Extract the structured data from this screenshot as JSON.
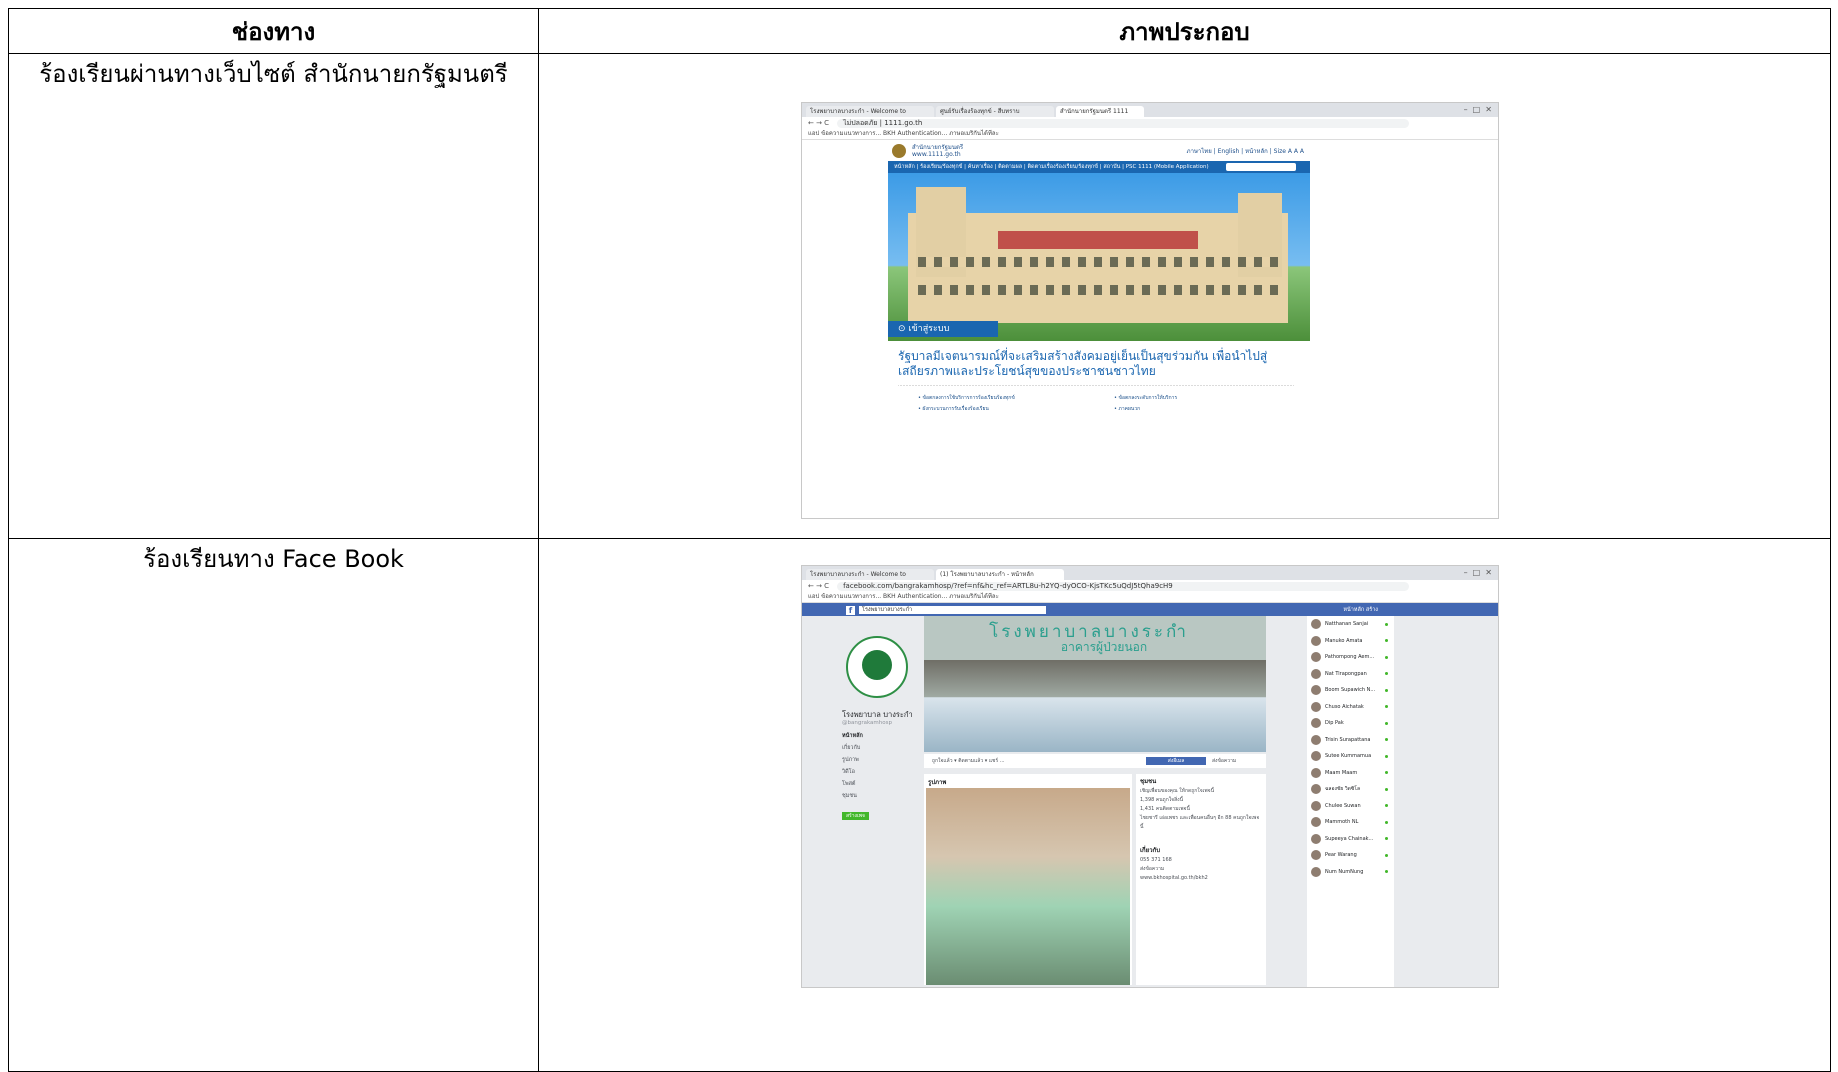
{
  "table": {
    "header_channel": "ช่องทาง",
    "header_image": "ภาพประกอบ",
    "rows": [
      {
        "channel": "ร้องเรียนผ่านทางเว็บไซต์ สำนักนายกรัฐมนตรี"
      },
      {
        "channel": "ร้องเรียนทาง Face Book"
      }
    ]
  },
  "screenshot1": {
    "tabs": [
      "โรงพยาบาลบางระกำ - Welcome to",
      "ศูนย์รับเรื่องร้องทุกข์ - สืบทราบ",
      "สำนักนายกรัฐมนตรี 1111"
    ],
    "url": "ไม่ปลอดภัย | 1111.go.th",
    "bookmarks": "แอป  ข้อความแนวทางการ...  BKH Authentication...  ภาษอเมริกันได้ทีละ",
    "site_name": "สำนักนายกรัฐมนตรี",
    "site_url": "www.1111.go.th",
    "site_links": "ภาษาไทย | English | หน้าหลัก | Size A A A",
    "nav": "หน้าหลัก | ร้องเรียน/ร้องทุกข์ | ค้นหาเรื่อง | ติดตามผล | ติดตามเรื่องร้องเรียน/ร้องทุกข์ | สถาบัน | PSC 1111 (Mobile Application)",
    "login": "เข้าสู่ระบบ",
    "headline": "รัฐบาลมีเจตนารมณ์ที่จะเสริมสร้างสังคมอยู่เย็นเป็นสุขร่วมกัน เพื่อนำไปสู่เสถียรภาพและประโยชน์สุขของประชาชนชาวไทย",
    "bullets": [
      "ข้อตกลงการใช้บริการการร้องเรียนร้องทุกข์",
      "ข้อตกลงระดับการให้บริการ",
      "ผังกระบวนการรับเรื่องร้องเรียน",
      "ภาคผนวก"
    ]
  },
  "screenshot2": {
    "tabs": [
      "โรงพยาบาลบางระกำ - Welcome to",
      "(1) โรงพยาบาลบางระกำ - หน้าหลัก"
    ],
    "url": "facebook.com/bangrakamhosp/?ref=nf&hc_ref=ARTL8u-h2YQ-dyOCO-KjsTKc5uQdJ5tQha9cH9",
    "bookmarks": "แอป  ข้อความแนวทางการ...  BKH Authentication...  ภาษอเมริกันได้ทีละ",
    "search": "โรงพยาบาลบางระกำ",
    "topright": "หน้าหลัก  สร้าง",
    "page_name": "โรงพยาบาล บางระกำ",
    "handle": "@bangrakamhosp",
    "menu": [
      "หน้าหลัก",
      "เกี่ยวกับ",
      "รูปภาพ",
      "วิดีโอ",
      "โพสต์",
      "ชุมชน"
    ],
    "create": "สร้างเพจ",
    "cover_title": "โรงพยาบาลบางระกำ",
    "cover_sub": "อาคารผู้ป่วยนอก",
    "actions": "ถูกใจแล้ว ▾   ติดตามแล้ว ▾   แชร์   ...",
    "send": "ส่งอีเมล",
    "message": "ส่งข้อความ",
    "photos": "รูปภาพ",
    "community": "ชุมชน",
    "community_lines": [
      "เชิญเพื่อนของคุณ ให้กดถูกใจเพจนี้",
      "1,398 คนถูกใจสิ่งนี้",
      "1,431 คนติดตามเพจนี้",
      "ไชยชารี เอ่อเพชร และเพื่อนคนอื่นๆ อีก 88 คนถูกใจเพจนี้"
    ],
    "about": "เกี่ยวกับ",
    "about_lines": [
      "055 371 168",
      "ส่งข้อความ",
      "www.bkhospital.go.th/bkh2"
    ],
    "chat": [
      "Natthanan Sanjai",
      "Manuko Amata",
      "Pathompong Aem...",
      "Nat Tirapongpan",
      "Boom Supawich N...",
      "Chuso Aichatak",
      "Dip Pak",
      "Trisin Surapattana",
      "Sutee Kummamua",
      "Maam Maam",
      "ฉลองชัย วิดซิโล",
      "Chulee Suwan",
      "Mammoth NL",
      "Supeeya Chainak...",
      "Pear Warang",
      "Num NumNung"
    ]
  }
}
